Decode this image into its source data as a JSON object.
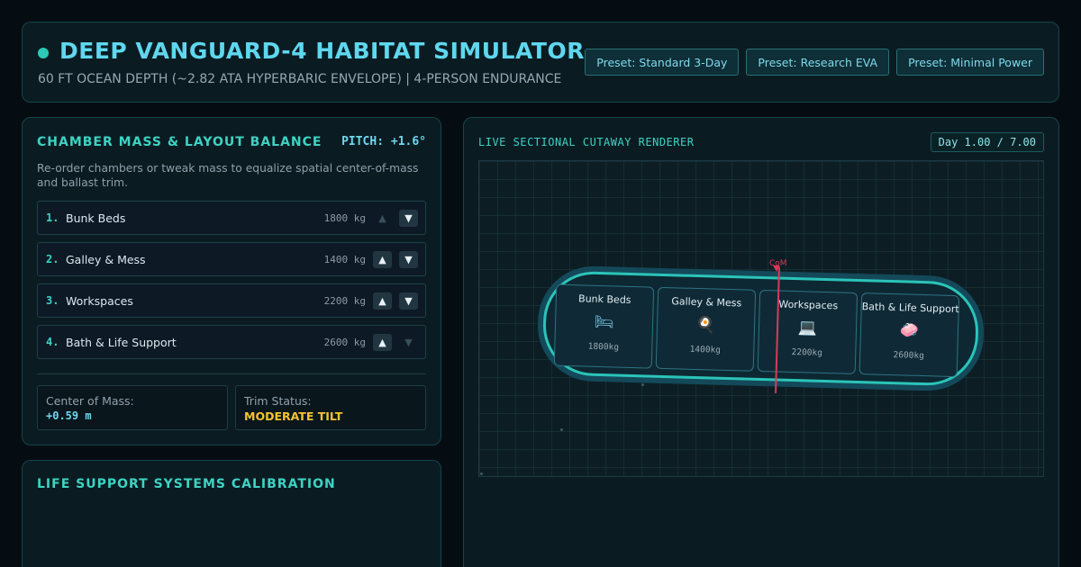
{
  "header": {
    "title": "DEEP VANGUARD-4 HABITAT SIMULATOR",
    "subtitle": "60 FT OCEAN DEPTH (~2.82 ATA HYPERBARIC ENVELOPE) | 4-PERSON ENDURANCE",
    "presets": [
      "Preset: Standard 3-Day",
      "Preset: Research EVA",
      "Preset: Minimal Power"
    ]
  },
  "chamber_panel": {
    "title": "CHAMBER MASS & LAYOUT BALANCE",
    "pitch": "PITCH: +1.6°",
    "description": "Re-order chambers or tweak mass to equalize spatial center-of-mass and ballast trim.",
    "chambers": [
      {
        "num": "1.",
        "name": "Bunk Beds",
        "mass": "1800 kg",
        "up_enabled": false,
        "down_enabled": true
      },
      {
        "num": "2.",
        "name": "Galley & Mess",
        "mass": "1400 kg",
        "up_enabled": true,
        "down_enabled": true
      },
      {
        "num": "3.",
        "name": "Workspaces",
        "mass": "2200 kg",
        "up_enabled": true,
        "down_enabled": true
      },
      {
        "num": "4.",
        "name": "Bath & Life Support",
        "mass": "2600 kg",
        "up_enabled": true,
        "down_enabled": false
      }
    ],
    "up_glyph": "▲",
    "down_glyph": "▼",
    "center_of_mass": {
      "label": "Center of Mass:",
      "value": "+0.59 m"
    },
    "trim_status": {
      "label": "Trim Status:",
      "value": "MODERATE TILT"
    }
  },
  "life_support": {
    "title": "LIFE SUPPORT SYSTEMS CALIBRATION"
  },
  "renderer": {
    "title": "LIVE SECTIONAL CUTAWAY RENDERER",
    "day": "Day 1.00 / 7.00",
    "com_label": "CoM",
    "cells": [
      {
        "name": "Bunk Beds",
        "icon": "bed-icon",
        "glyph": "🛏",
        "mass": "1800kg"
      },
      {
        "name": "Galley & Mess",
        "icon": "frying-pan-icon",
        "glyph": "🍳",
        "mass": "1400kg"
      },
      {
        "name": "Workspaces",
        "icon": "laptop-icon",
        "glyph": "💻",
        "mass": "2200kg"
      },
      {
        "name": "Bath & Life Support",
        "icon": "soap-icon",
        "glyph": "🧼",
        "mass": "2600kg"
      }
    ]
  },
  "colors": {
    "accent": "#3fd2c3",
    "highlight": "#5fd7ee",
    "warning": "#f4c430",
    "com_line": "#d83a5c",
    "background": "#050d12"
  }
}
